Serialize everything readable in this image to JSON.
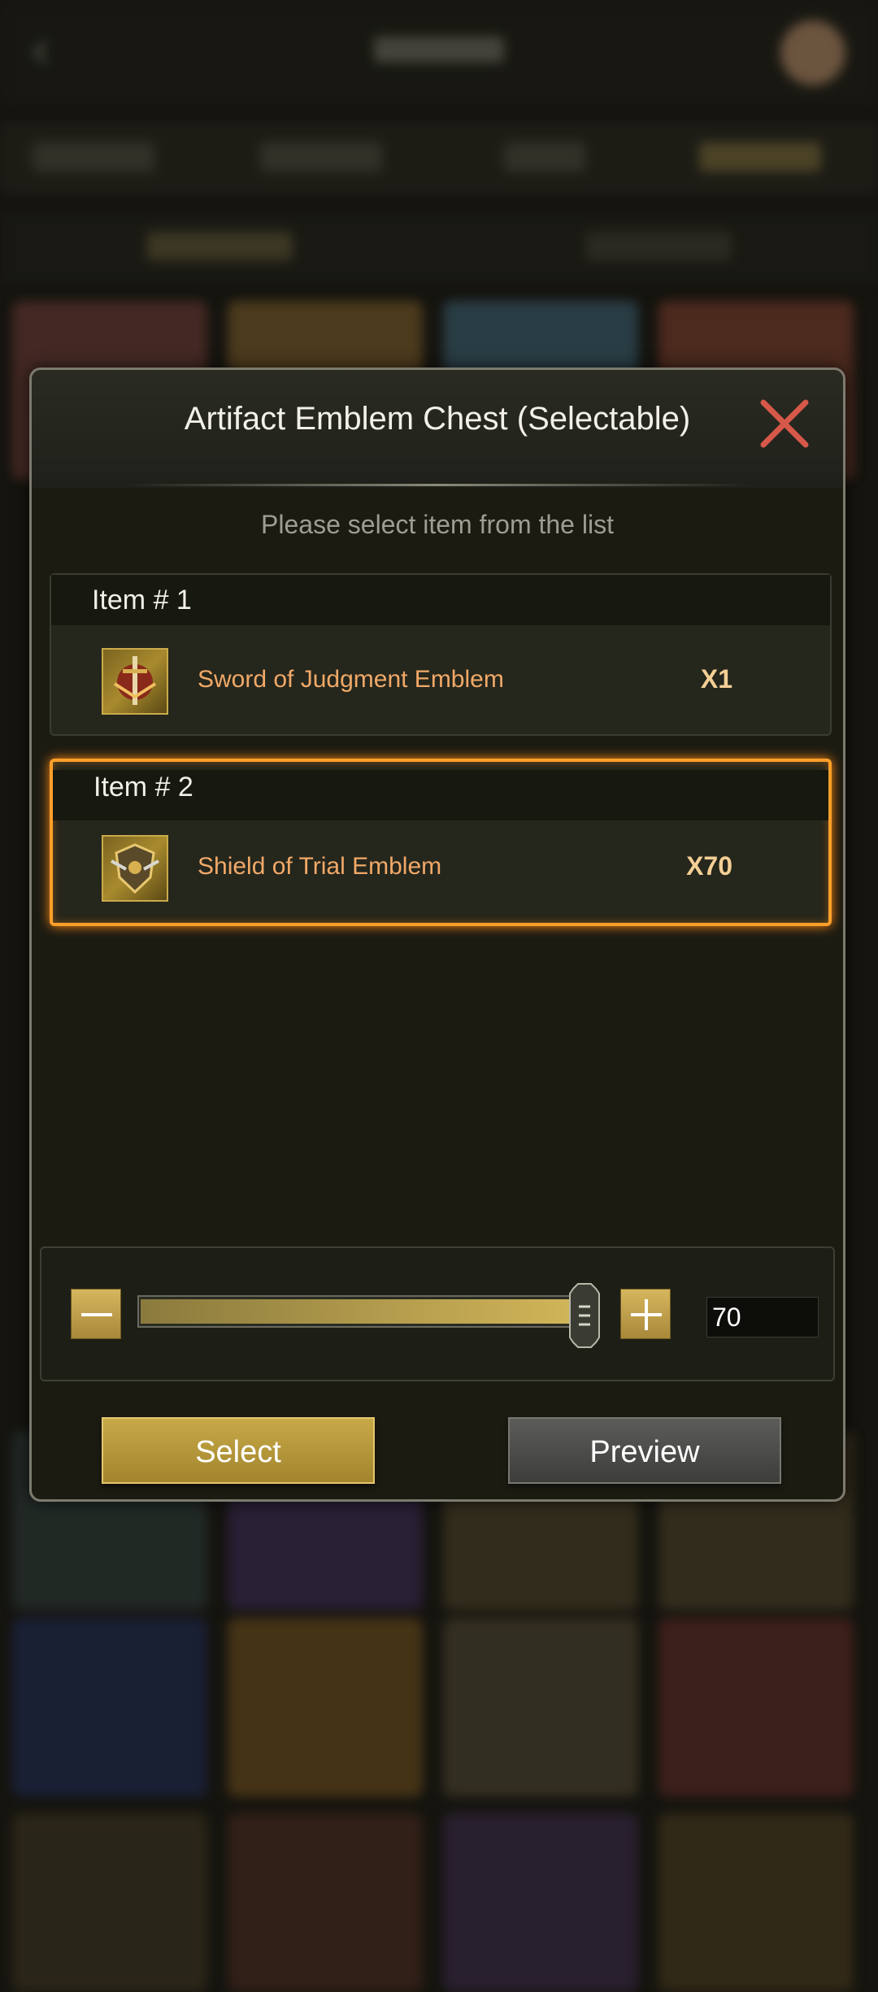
{
  "dialog": {
    "title": "Artifact Emblem Chest (Selectable)",
    "instruction": "Please select item from the list",
    "close_icon": "close-x-icon"
  },
  "items": [
    {
      "index_label": "Item # 1",
      "name": "Sword of Judgment Emblem",
      "quantity": "X1",
      "icon": "sword-emblem-icon",
      "selected": false
    },
    {
      "index_label": "Item # 2",
      "name": "Shield of Trial Emblem",
      "quantity": "X70",
      "icon": "shield-emblem-icon",
      "selected": true
    }
  ],
  "quantity": {
    "value": "70",
    "slider_fraction": 1.0,
    "decrease_icon": "minus-icon",
    "increase_icon": "plus-icon"
  },
  "buttons": {
    "select_label": "Select",
    "preview_label": "Preview"
  },
  "colors": {
    "accent_gold": "#c7a948",
    "selected_glow": "#ff9f2a",
    "item_name": "#f1a968",
    "close_red": "#d6584a"
  }
}
